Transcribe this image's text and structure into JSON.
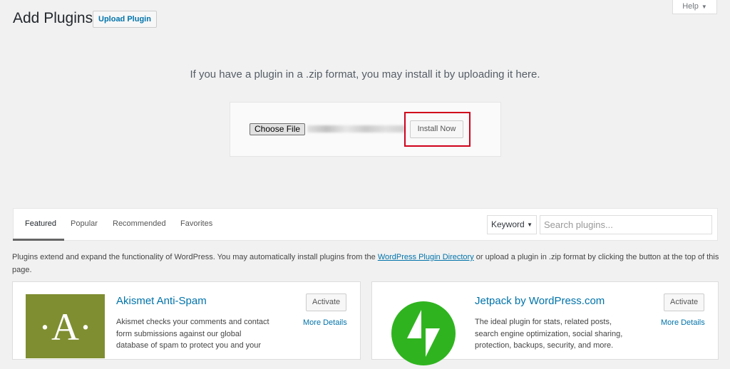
{
  "header": {
    "title": "Add Plugins",
    "upload_button": "Upload Plugin",
    "help_label": "Help"
  },
  "upload": {
    "instruction": "If you have a plugin in a .zip format, you may install it by uploading it here.",
    "choose_file_label": "Choose File",
    "install_label": "Install Now"
  },
  "filter": {
    "tabs": [
      "Featured",
      "Popular",
      "Recommended",
      "Favorites"
    ],
    "active_tab": "Featured",
    "search_type": "Keyword",
    "search_placeholder": "Search plugins..."
  },
  "description": {
    "text_before": "Plugins extend and expand the functionality of WordPress. You may automatically install plugins from the ",
    "link_text": "WordPress Plugin Directory",
    "text_after": " or upload a plugin in .zip format by clicking the button at the top of this page."
  },
  "plugins": [
    {
      "name": "Akismet Anti-Spam",
      "description_lines": [
        "Akismet checks your comments and contact",
        "form submissions against our global",
        "database of spam to protect you and your"
      ],
      "action_label": "Activate",
      "details_label": "More Details",
      "logo_letter": "·A·",
      "logo_color": "#7f8e31"
    },
    {
      "name": "Jetpack by WordPress.com",
      "description_lines": [
        "The ideal plugin for stats, related posts,",
        "search engine optimization, social sharing,",
        "protection, backups, security, and more."
      ],
      "action_label": "Activate",
      "details_label": "More Details",
      "logo_color": "#2fb41f"
    }
  ],
  "colors": {
    "link": "#0073aa",
    "highlight_border": "#d0021b",
    "background": "#f1f1f1"
  }
}
